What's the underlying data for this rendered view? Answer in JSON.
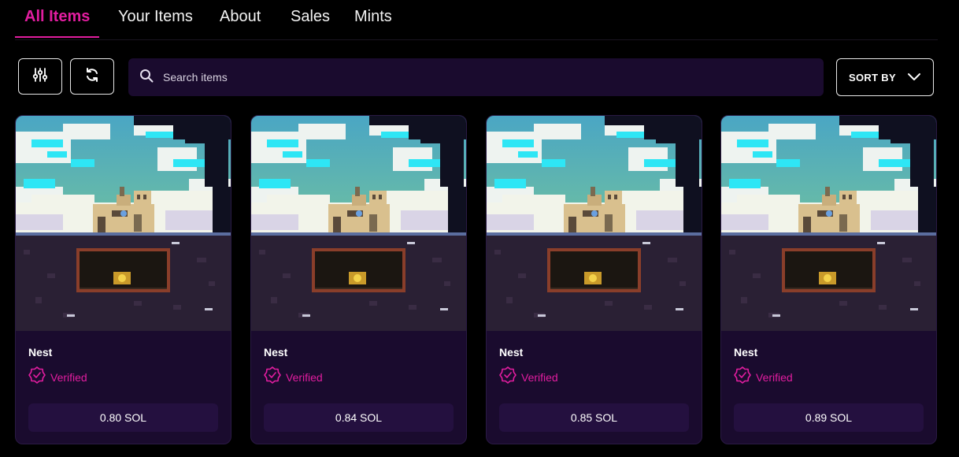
{
  "tabs": [
    {
      "label": "All Items",
      "active": true
    },
    {
      "label": "Your Items",
      "active": false
    },
    {
      "label": "About",
      "active": false
    },
    {
      "label": "Sales",
      "active": false
    },
    {
      "label": "Mints",
      "active": false
    }
  ],
  "toolbar": {
    "filter_icon": "sliders-icon",
    "refresh_icon": "refresh-icon",
    "search_placeholder": "Search items",
    "sort_label": "SORT BY"
  },
  "colors": {
    "accent": "#e11d9f",
    "card_bg": "#1a0b2e",
    "price_bg": "#24103f"
  },
  "items": [
    {
      "name": "Nest",
      "verified_label": "Verified",
      "price": "0.80 SOL"
    },
    {
      "name": "Nest",
      "verified_label": "Verified",
      "price": "0.84 SOL"
    },
    {
      "name": "Nest",
      "verified_label": "Verified",
      "price": "0.85 SOL"
    },
    {
      "name": "Nest",
      "verified_label": "Verified",
      "price": "0.89 SOL"
    }
  ]
}
